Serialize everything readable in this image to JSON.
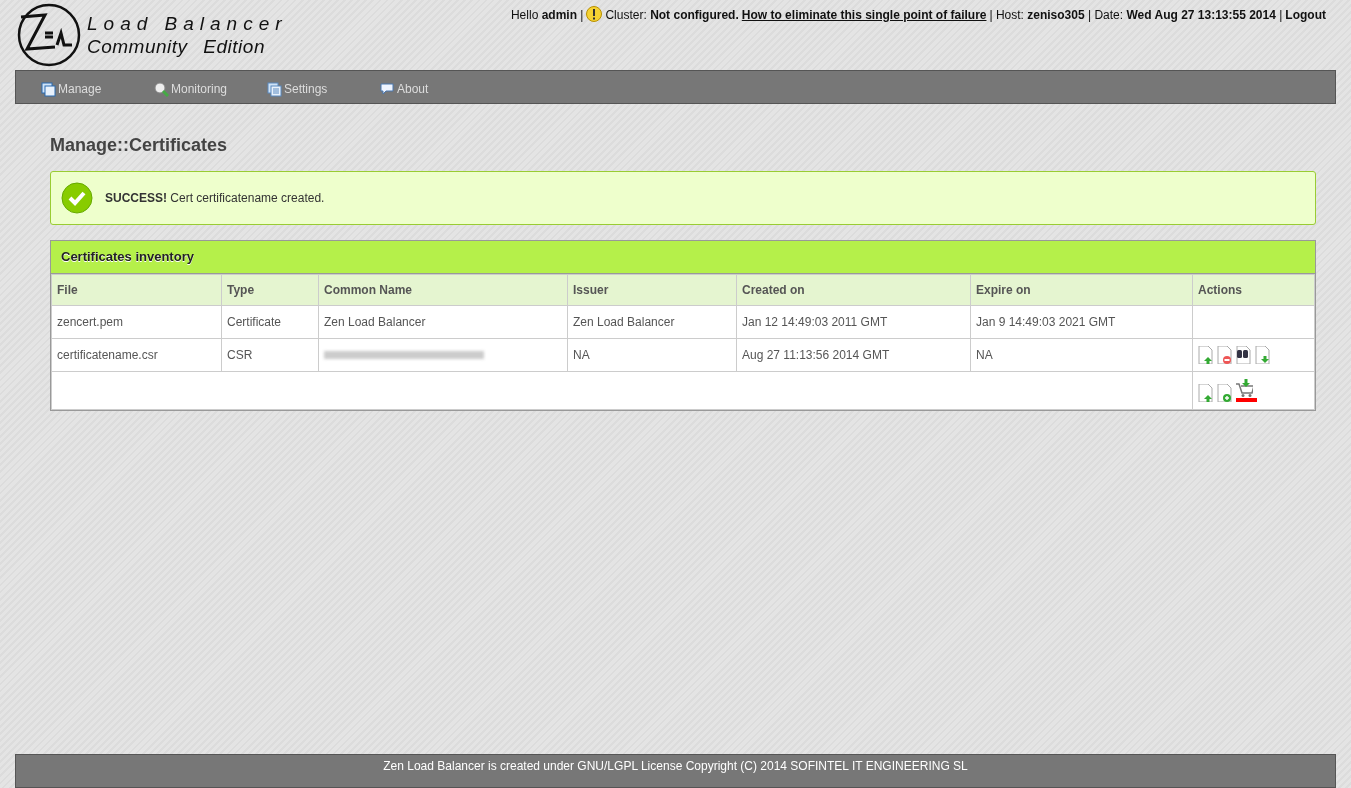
{
  "logo": {
    "line1": "Load Balancer",
    "line2": "Community Edition"
  },
  "header": {
    "greeting": "Hello **admin** |",
    "cluster": "Cluster: **Not configured.**",
    "cluster_link": "How to eliminate this single point of failure",
    "host": "| Host: **zeniso305** | Date: **Wed Aug 27 13:13:55 2014** |",
    "logout": "Logout"
  },
  "menu": [
    {
      "label": "Manage",
      "kind": "manage"
    },
    {
      "label": "Monitoring",
      "kind": "monitoring"
    },
    {
      "label": "Settings",
      "kind": "settings"
    },
    {
      "label": "About",
      "kind": "about"
    }
  ],
  "page_title": "Manage::Certificates",
  "alert": "**SUCCESS!** Cert certificatename created.",
  "table": {
    "title": "Certificates inventory",
    "columns": [
      "File",
      "Type",
      "Common Name",
      "Issuer",
      "Created on",
      "Expire on",
      "Actions"
    ],
    "rows": [
      {
        "cells": [
          "zencert.pem",
          "Certificate",
          "Zen Load Balancer",
          "Zen Load Balancer",
          "Jan 12 14:49:03 2011 GMT",
          "Jan 9 14:49:03 2021 GMT"
        ],
        "blurred": false,
        "actions": []
      },
      {
        "cells": [
          "certificatename.csr",
          "CSR",
          "",
          "NA",
          "Aug 27 11:13:56 2014 GMT",
          "NA"
        ],
        "blurred": true,
        "actions": [
          {
            "kind": "upload",
            "highlighted": false
          },
          {
            "kind": "delete",
            "highlighted": false
          },
          {
            "kind": "view",
            "highlighted": false
          },
          {
            "kind": "download",
            "highlighted": false
          }
        ]
      }
    ],
    "footer_actions": [
      {
        "kind": "upload",
        "highlighted": false
      },
      {
        "kind": "add",
        "highlighted": false
      },
      {
        "kind": "cart",
        "highlighted": true
      }
    ]
  },
  "footer": "Zen Load Balancer is created under GNU/LGPL License Copyright (C) 2014 SOFINTEL IT ENGINEERING SL"
}
